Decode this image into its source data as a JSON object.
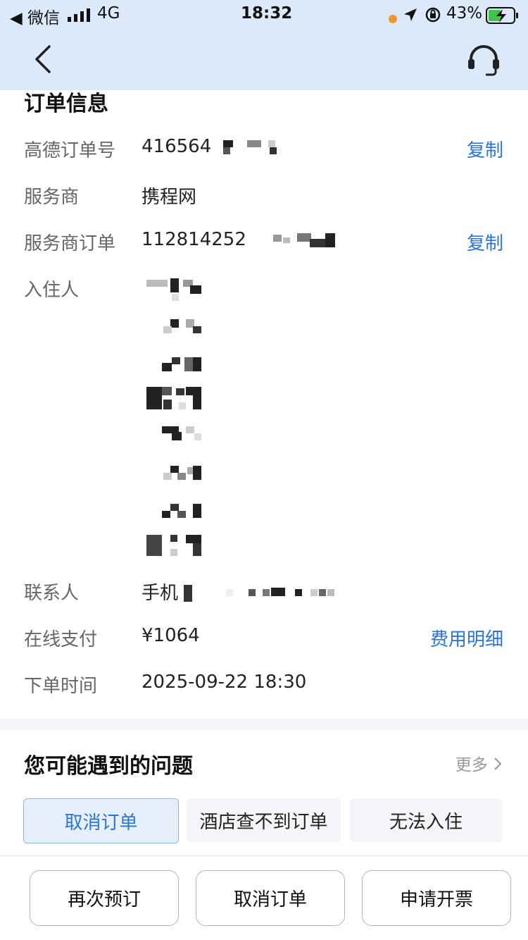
{
  "status_bar": {
    "back_app": "◀ 微信",
    "network": "4G",
    "time": "18:32",
    "battery": "43%"
  },
  "order_info": {
    "title": "订单信息",
    "rows": [
      {
        "label": "高德订单号",
        "value": "416564",
        "action": "复制"
      },
      {
        "label": "服务商",
        "value": "携程网"
      },
      {
        "label": "服务商订单",
        "value": "112814252",
        "action": "复制"
      },
      {
        "label": "入住人",
        "value": ""
      },
      {
        "label": "联系人",
        "value": "手机"
      },
      {
        "label": "在线支付",
        "value": "¥1064",
        "action": "费用明细"
      },
      {
        "label": "下单时间",
        "value": "2025-09-22 18:30"
      }
    ]
  },
  "problems": {
    "title": "您可能遇到的问题",
    "more": "更多",
    "chips": [
      "取消订单",
      "酒店查不到订单",
      "无法入住"
    ]
  },
  "bottom_buttons": [
    "再次预订",
    "取消订单",
    "申请开票"
  ],
  "colors": {
    "accent": "#2b74d8",
    "header_bg": "#dbe9f8"
  }
}
